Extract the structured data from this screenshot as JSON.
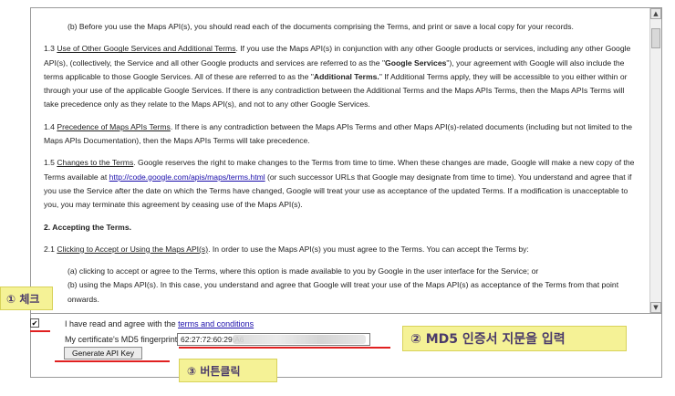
{
  "terms": {
    "p_b": "(b) Before you use the Maps API(s), you should read each of the documents comprising the Terms, and print or save a local copy for your records.",
    "p13_num": "1.3 ",
    "p13_title": "Use of Other Google Services and Additional Terms",
    "p13_a": ". If you use the Maps API(s) in conjunction with any other Google products or services, including any other Google API(s), (collectively, the Service and all other Google products and services are referred to as the \"",
    "p13_gs": "Google Services",
    "p13_b": "\"), your agreement with Google will also include the terms applicable to those Google Services. All of these are referred to as the \"",
    "p13_at": "Additional Terms.",
    "p13_c": "\" If Additional Terms apply, they will be accessible to you either within or through your use of the applicable Google Services. If there is any contradiction between the Additional Terms and the Maps APIs Terms, then the Maps APIs Terms will take precedence only as they relate to the Maps API(s), and not to any other Google Services.",
    "p14_num": "1.4 ",
    "p14_title": "Precedence of Maps APIs Terms",
    "p14_text": ". If there is any contradiction between the Maps APIs Terms and other Maps API(s)-related documents (including but not limited to the Maps APIs Documentation), then the Maps APIs Terms will take precedence.",
    "p15_num": "1.5 ",
    "p15_title": "Changes to the Terms",
    "p15_a": ". Google reserves the right to make changes to the Terms from time to time. When these changes are made, Google will make a new copy of the Terms available at ",
    "p15_link": "http://code.google.com/apis/maps/terms.html",
    "p15_b": " (or such successor URLs that Google may designate from time to time). You understand and agree that if you use the Service after the date on which the Terms have changed, Google will treat your use as acceptance of the updated Terms. If a modification is unacceptable to you, you may terminate this agreement by ceasing use of the Maps API(s).",
    "s2_heading": "2. Accepting the Terms.",
    "p21_num": "2.1 ",
    "p21_title": "Clicking to Accept or Using the Maps API(s)",
    "p21_text": ". In order to use the Maps API(s) you must agree to the Terms. You can accept the Terms by:",
    "item_a": "(a) clicking to accept or agree to the Terms, where this option is made available to you by Google in the user interface for the Service; or",
    "item_b": "(b) using the Maps API(s). In this case, you understand and agree that Google will treat your use of the Maps API(s) as acceptance of the Terms from that point onwards."
  },
  "scroll": {
    "up_glyph": "▲",
    "down_glyph": "▼",
    "position": 0.05
  },
  "form": {
    "agree_checked": true,
    "agree_mark": "✔",
    "agree_text": "I have read and agree with the ",
    "agree_link": "terms and conditions",
    "md5_label": "My certificate's MD5 fingerprint:",
    "md5_value": "62:27:72:60:29:A6",
    "generate_button": "Generate API Key"
  },
  "annotations": {
    "callout1": "① 체크",
    "callout2": "② MD5 인증서 지문을 입력",
    "callout3": "③ 버튼클릭",
    "highlight_color": "#f5f296",
    "line_color": "#e02020"
  }
}
